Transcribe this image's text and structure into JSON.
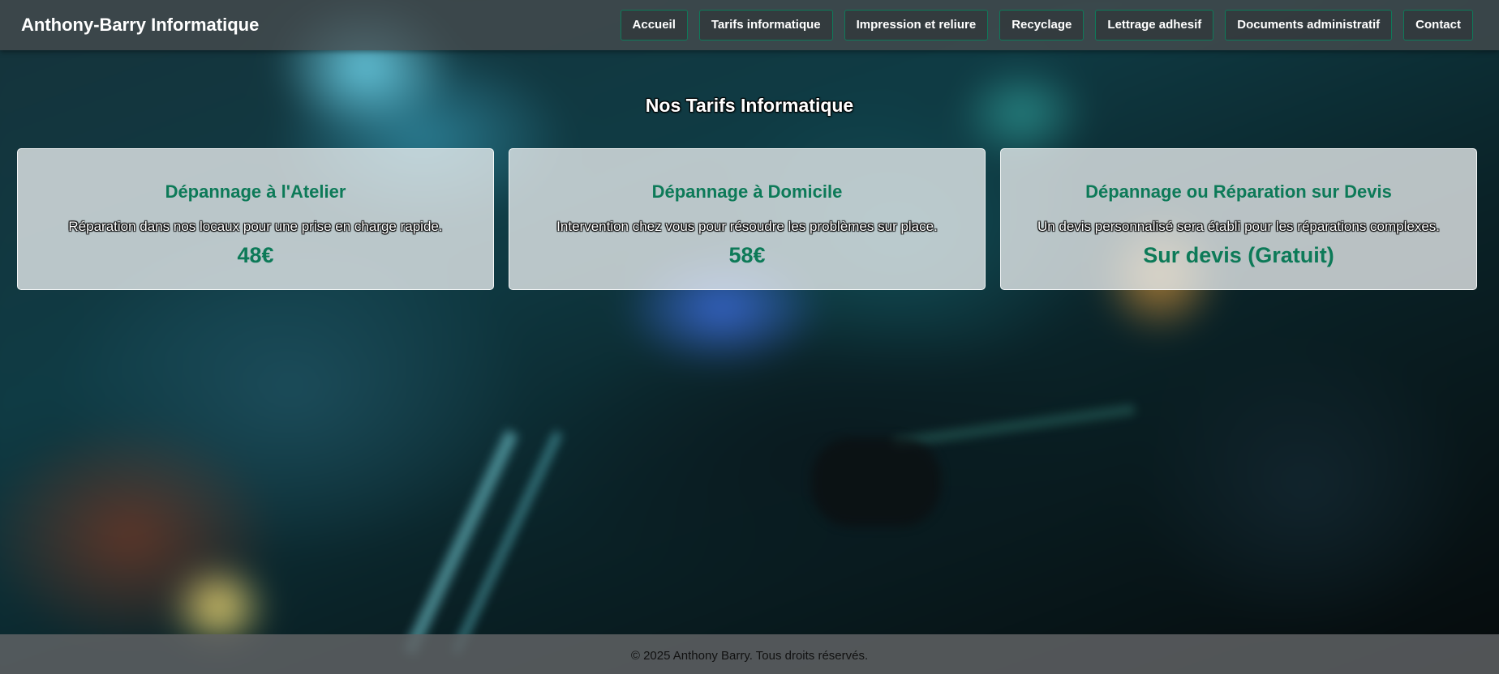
{
  "header": {
    "brand": "Anthony-Barry Informatique",
    "nav": [
      {
        "label": "Accueil"
      },
      {
        "label": "Tarifs informatique"
      },
      {
        "label": "Impression et reliure"
      },
      {
        "label": "Recyclage"
      },
      {
        "label": "Lettrage adhesif"
      },
      {
        "label": "Documents administratif"
      },
      {
        "label": "Contact"
      }
    ]
  },
  "main": {
    "title": "Nos Tarifs Informatique",
    "cards": [
      {
        "title": "Dépannage à l'Atelier",
        "description": "Réparation dans nos locaux pour une prise en charge rapide.",
        "price": "48€"
      },
      {
        "title": "Dépannage à Domicile",
        "description": "Intervention chez vous pour résoudre les problèmes sur place.",
        "price": "58€"
      },
      {
        "title": "Dépannage ou Réparation sur Devis",
        "description": "Un devis personnalisé sera établi pour les réparations complexes.",
        "price": "Sur devis (Gratuit)"
      }
    ]
  },
  "footer": {
    "text": "© 2025 Anthony Barry. Tous droits réservés."
  },
  "colors": {
    "accent": "#0d7a58",
    "header_bg": "#464b4e",
    "footer_bg": "#5f6264"
  }
}
